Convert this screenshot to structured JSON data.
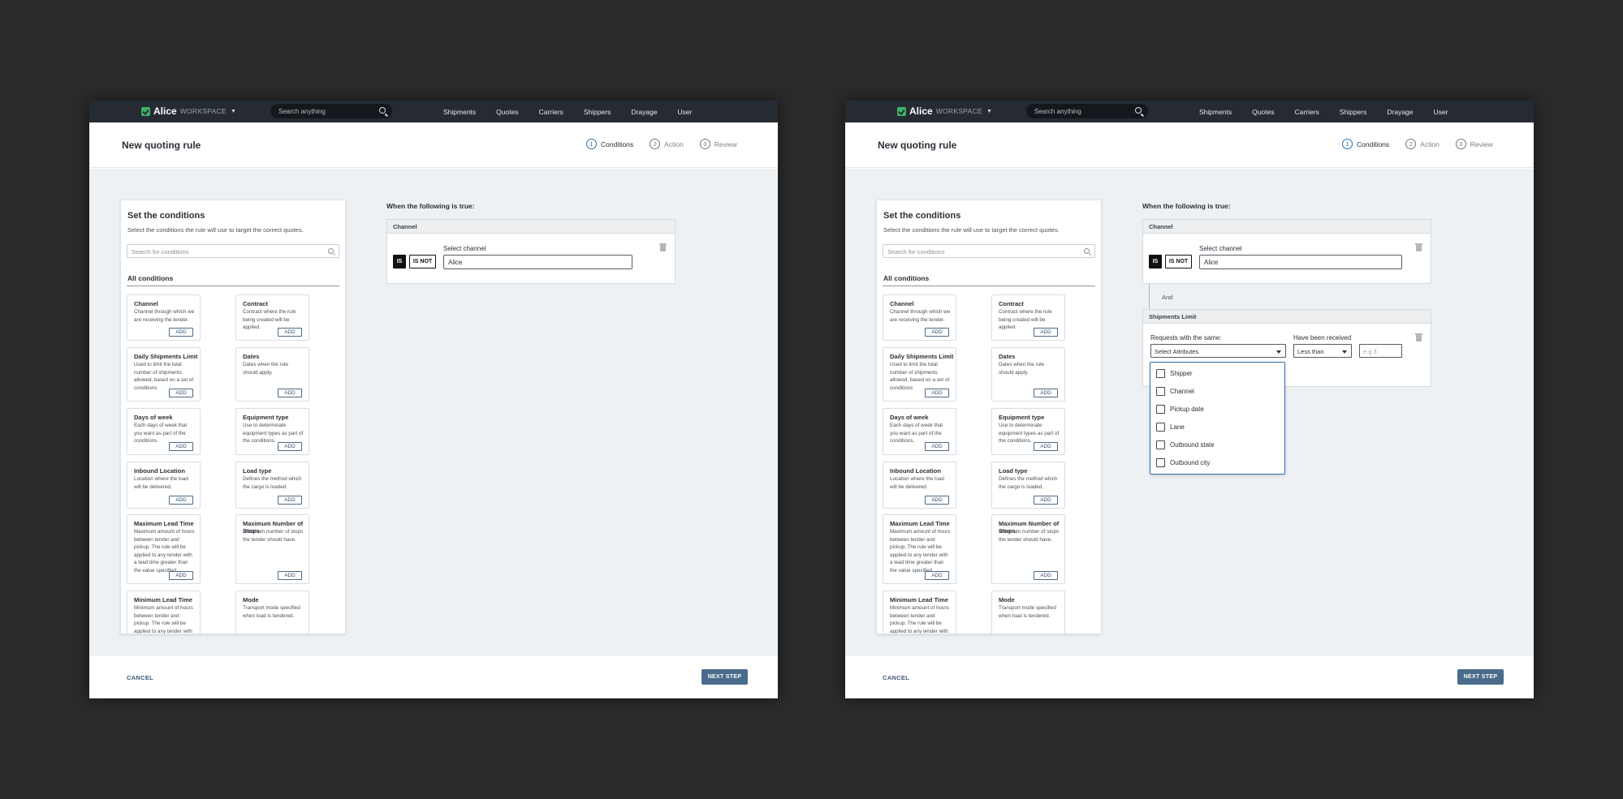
{
  "nav": {
    "brand": "Alice",
    "brand_suffix": "WORKSPACE",
    "search_placeholder": "Search anything",
    "links": [
      "Shipments",
      "Quotes",
      "Carriers",
      "Shippers",
      "Drayage",
      "User"
    ]
  },
  "header": {
    "title": "New quoting rule",
    "steps": [
      {
        "num": "1",
        "label": "Conditions",
        "active": true
      },
      {
        "num": "2",
        "label": "Action",
        "active": false
      },
      {
        "num": "3",
        "label": "Review",
        "active": false
      }
    ]
  },
  "conditions_panel": {
    "title": "Set the conditions",
    "subtitle": "Select the conditions the rule will use to target the correct quotes.",
    "search_placeholder": "Search for conditions",
    "all_label": "All conditions",
    "add_label": "ADD",
    "cards": [
      {
        "title": "Channel",
        "desc": "Channel through which we are receiving the tender."
      },
      {
        "title": "Contract",
        "desc": "Contract where the rule being created will be applied."
      },
      {
        "title": "Daily Shipments Limit",
        "desc": "Used to limit the total number of shipments allowed, based on a set of conditions"
      },
      {
        "title": "Dates",
        "desc": "Dates when the rule should apply."
      },
      {
        "title": "Days of week",
        "desc": "Each days of week that you want as part of the conditions."
      },
      {
        "title": "Equipment type",
        "desc": "Use to determinate equipment types as part of the conditions."
      },
      {
        "title": "Inbound Location",
        "desc": "Location where the load will be delivered."
      },
      {
        "title": "Load type",
        "desc": "Defines the method which the cargo is loaded."
      },
      {
        "title": "Maximum Lead Time",
        "desc": "Maximum amount of hours between tender and pickup. The rule will be applied to any tender with a lead time greater than the value specified."
      },
      {
        "title": "Maximum Number of Stops",
        "desc": "Maximum number of stops the tender should have."
      },
      {
        "title": "Minimum Lead Time",
        "desc": "Minimum amount of hours between tender and pickup. The rule will be applied to any tender with a lead time less than the value specified."
      },
      {
        "title": "Mode",
        "desc": "Transport mode specified when load is tendered."
      }
    ]
  },
  "rule": {
    "heading": "When the following is true:",
    "channel": {
      "header": "Channel",
      "is_label": "IS",
      "is_not_label": "IS NOT",
      "field_label": "Select channel",
      "value": "Alice"
    },
    "and_label": "And",
    "shipments_limit": {
      "header": "Shipments Limit",
      "requests_label": "Requests with the same:",
      "attributes_value": "Select Attributes",
      "received_label": "Have been received",
      "comparator_value": "Less than",
      "number_placeholder": "e.g 3",
      "options": [
        "Shipper",
        "Channel",
        "Pickup date",
        "Lane",
        "Outbound state",
        "Outbound city"
      ]
    }
  },
  "footer": {
    "cancel": "CANCEL",
    "next": "NEXT STEP"
  }
}
